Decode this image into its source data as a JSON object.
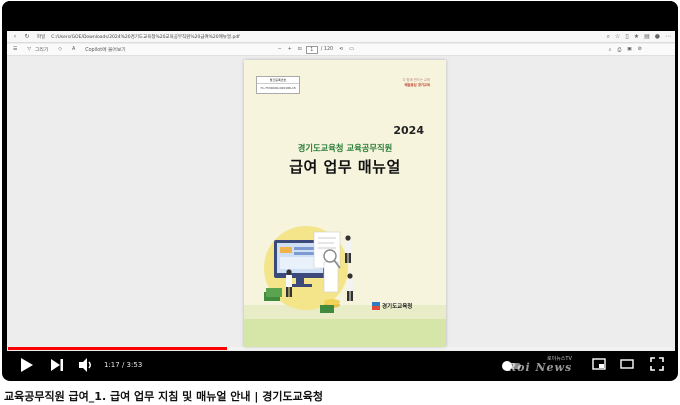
{
  "browser": {
    "url": "C:/Users/GOE/Downloads/2024%20경기도교육청%20교육공무직원%20급여%20매뉴얼.pdf",
    "file_label": "파일",
    "draw_label": "그리기",
    "copilot_label": "Copilot에 물어보기",
    "page_current": "1",
    "page_total": "/ 120"
  },
  "document": {
    "stamp_title": "발간등록번호",
    "stamp_number": "71-7530000-000186-15",
    "slogan_line1": "다 함께 만드는 교육",
    "slogan_line2": "배움중심 경기교육",
    "year": "2024",
    "subtitle": "경기도교육청 교육공무직원",
    "title": "급여 업무 매뉴얼",
    "publisher": "경기도교육청"
  },
  "player": {
    "time_current": "1:17",
    "time_separator": " / ",
    "time_total": "3:53",
    "progress": 0.33,
    "watermark": "Roi News",
    "watermark_small": "로이뉴스TV",
    "accent": "#ff0000"
  },
  "caption": {
    "title": "교육공무직원 급여_1. 급여 업무 지침 및 매뉴얼 안내 |  경기도교육청"
  }
}
